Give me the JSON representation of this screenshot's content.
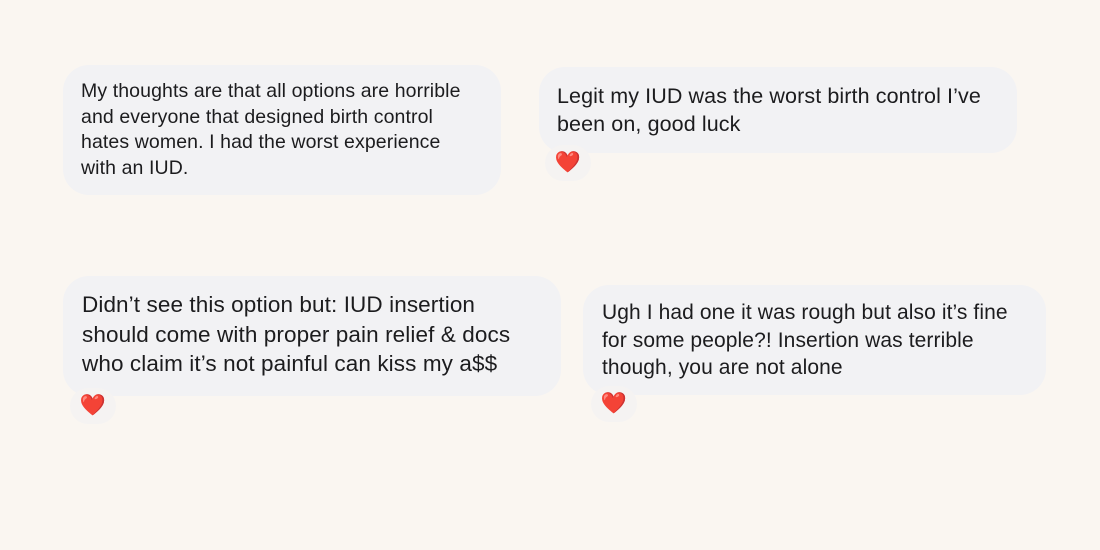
{
  "messages": [
    {
      "text": "My thoughts are that all options are horrible\nand everyone that designed birth control\nhates women. I had the worst experience\nwith an IUD.",
      "reaction": null
    },
    {
      "text": "Legit my IUD was the worst birth control I’ve\nbeen on, good luck",
      "reaction": "❤️"
    },
    {
      "text": "Didn’t see this option but: IUD insertion\nshould come with proper pain relief & docs\nwho claim it’s not painful can kiss my a$$",
      "reaction": "❤️"
    },
    {
      "text": "Ugh I had one it was rough but also it’s fine\nfor some people?! Insertion was terrible\nthough, you are not alone",
      "reaction": "❤️"
    }
  ],
  "colors": {
    "background": "#faf6f1",
    "bubble": "#f2f2f4",
    "text": "#1c1c1e",
    "heart": "#e8231d"
  },
  "icons": {
    "reaction": "red-heart-icon"
  }
}
